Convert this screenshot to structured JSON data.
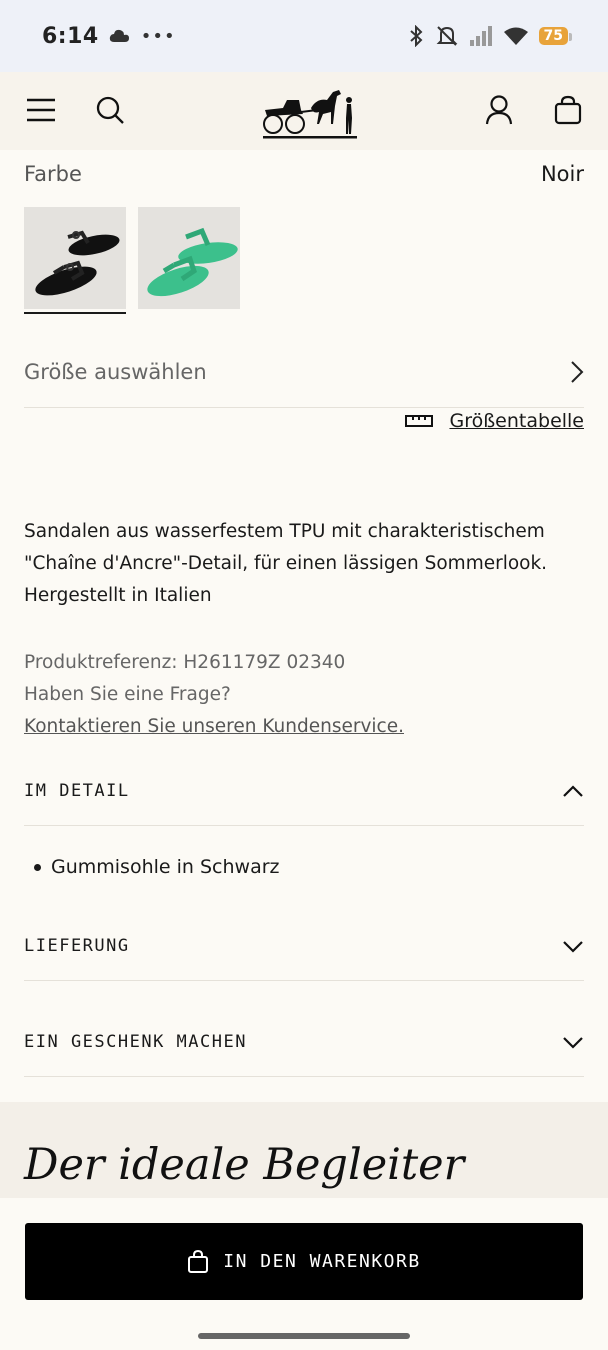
{
  "status_bar": {
    "time": "6:14",
    "battery": "75"
  },
  "header": {
    "menu_icon": "menu-icon",
    "search_icon": "search-icon",
    "logo_icon": "carriage-logo-icon",
    "account_icon": "account-icon",
    "bag_icon": "shopping-bag-icon"
  },
  "color": {
    "label": "Farbe",
    "value": "Noir",
    "swatches": [
      {
        "name": "Noir",
        "color": "#111111",
        "selected": true
      },
      {
        "name": "Vert",
        "color": "#3cc08c",
        "selected": false
      }
    ]
  },
  "size": {
    "select_label": "Größe auswählen",
    "table_link": "Größentabelle"
  },
  "description": {
    "line1": "Sandalen aus wasserfestem TPU mit charakteristischem",
    "line2": "\"Chaîne d'Ancre\"-Detail, für einen lässigen Sommerlook.",
    "line3": "Hergestellt in Italien"
  },
  "meta": {
    "reference": "Produktreferenz:  H261179Z 02340",
    "question": "Haben Sie eine Frage?",
    "contact_link": "Kontaktieren Sie unseren Kundenservice."
  },
  "accordion": {
    "detail_title": "IM DETAIL",
    "detail_item": "Gummisohle in Schwarz",
    "delivery_title": "LIEFERUNG",
    "gift_title": "EIN GESCHENK MACHEN"
  },
  "companion": {
    "title": "Der ideale Begleiter"
  },
  "cart": {
    "button_label": "IN DEN WARENKORB"
  }
}
